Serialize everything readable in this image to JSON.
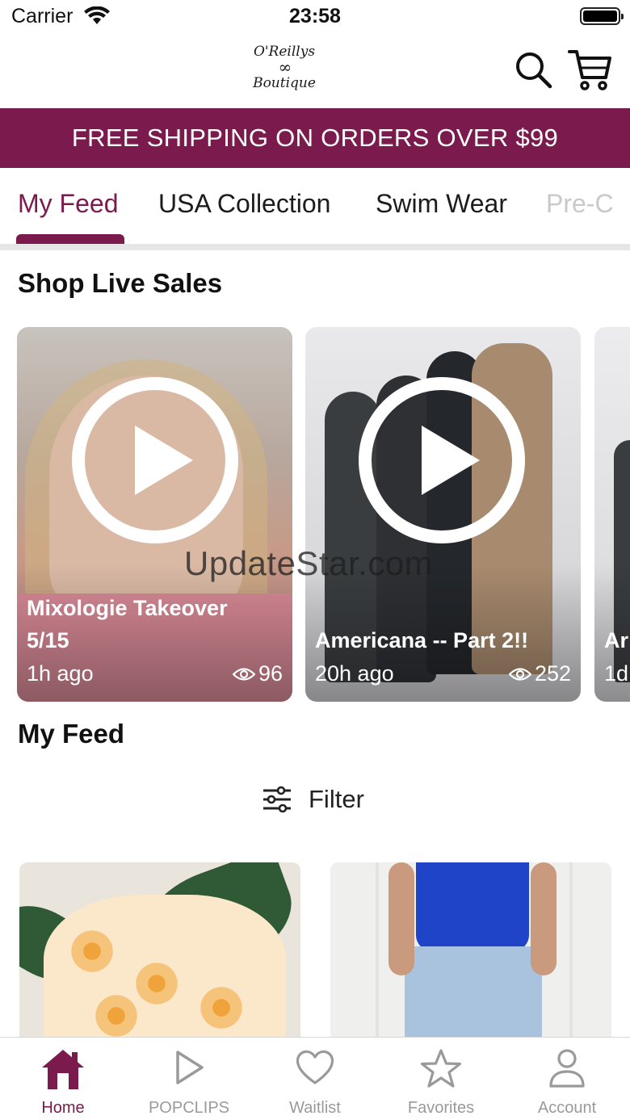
{
  "status_bar": {
    "carrier": "Carrier",
    "time": "23:58"
  },
  "header": {
    "logo": {
      "line1": "O'Reillys",
      "line2": "∞",
      "line3": "Boutique"
    }
  },
  "banner": {
    "text": "FREE SHIPPING ON ORDERS OVER $99"
  },
  "tabs": [
    {
      "label": "My Feed",
      "active": true
    },
    {
      "label": "USA Collection",
      "active": false
    },
    {
      "label": "Swim Wear",
      "active": false
    },
    {
      "label": "Pre-C",
      "active": false
    }
  ],
  "live_section": {
    "title": "Shop Live Sales",
    "cards": [
      {
        "title": "Mixologie Takeover 5/15",
        "time": "1h ago",
        "views": "96"
      },
      {
        "title": "Americana -- Part 2!!",
        "time": "20h ago",
        "views": "252"
      },
      {
        "title": "Ar",
        "time": "1d"
      }
    ]
  },
  "watermark": "UpdateStar.com",
  "feed_section": {
    "title": "My Feed",
    "filter_label": "Filter"
  },
  "bottom_nav": [
    {
      "label": "Home",
      "icon": "home-icon",
      "active": true
    },
    {
      "label": "POPCLIPS",
      "icon": "play-icon",
      "active": false
    },
    {
      "label": "Waitlist",
      "icon": "heart-icon",
      "active": false
    },
    {
      "label": "Favorites",
      "icon": "star-icon",
      "active": false
    },
    {
      "label": "Account",
      "icon": "person-icon",
      "active": false
    }
  ],
  "colors": {
    "brand": "#7b1a4d",
    "nav_inactive": "#9a9a9a"
  }
}
